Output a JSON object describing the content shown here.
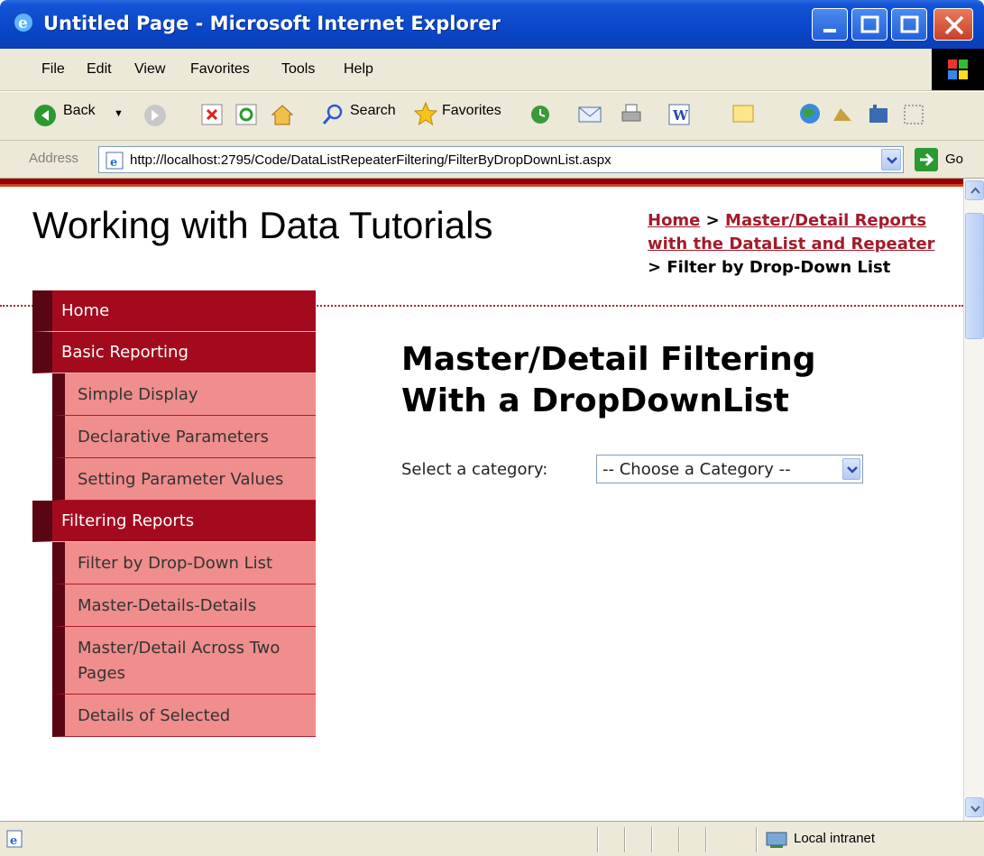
{
  "window": {
    "title": "Untitled Page - Microsoft Internet Explorer"
  },
  "menu": [
    "File",
    "Edit",
    "View",
    "Favorites",
    "Tools",
    "Help"
  ],
  "toolbar": {
    "back_label": "Back",
    "search_label": "Search",
    "favorites_label": "Favorites"
  },
  "address": {
    "label": "Address",
    "url": "http://localhost:2795/Code/DataListRepeaterFiltering/FilterByDropDownList.aspx",
    "go_label": "Go"
  },
  "page": {
    "site_title": "Working with Data Tutorials",
    "breadcrumb": {
      "home": "Home",
      "sep1": " > ",
      "parent": "Master/Detail Reports with the DataList and Repeater",
      "sep2": " > ",
      "current": "Filter by Drop-Down List"
    },
    "nav": {
      "home": "Home",
      "basic": "Basic Reporting",
      "simple_display": "Simple Display",
      "declarative": "Declarative Parameters",
      "setting_param": "Setting Parameter Values",
      "filtering": "Filtering Reports",
      "filter_dropdown": "Filter by Drop-Down List",
      "mdd": "Master-Details-Details",
      "master_detail_pages": "Master/Detail Across Two Pages",
      "details_selected": "Details of Selected"
    },
    "heading": "Master/Detail Filtering With a DropDownList",
    "category_label": "Select a category:",
    "category_selected": "-- Choose a Category --"
  },
  "status": {
    "zone": "Local intranet"
  },
  "colors": {
    "title_blue": "#0a46c8",
    "nav_dark": "#a30a1e",
    "nav_light": "#f08d8d",
    "link": "#a21b2a"
  }
}
